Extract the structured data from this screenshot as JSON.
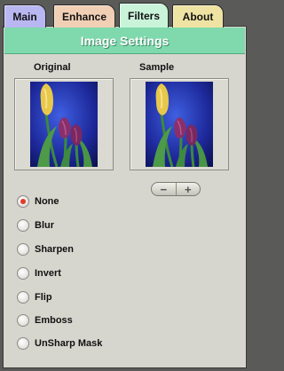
{
  "tabs": [
    {
      "label": "Main",
      "color": "#b9b6f2"
    },
    {
      "label": "Enhance",
      "color": "#f1cfb5"
    },
    {
      "label": "Filters",
      "color": "#c9f4d9",
      "active": true
    },
    {
      "label": "About",
      "color": "#efe3a3"
    }
  ],
  "header": {
    "title": "Image Settings",
    "color": "#7fd9ac"
  },
  "preview": {
    "original_label": "Original",
    "sample_label": "Sample"
  },
  "zoom": {
    "minus": "−",
    "plus": "+"
  },
  "filters": [
    {
      "label": "None",
      "selected": true
    },
    {
      "label": "Blur",
      "selected": false
    },
    {
      "label": "Sharpen",
      "selected": false
    },
    {
      "label": "Invert",
      "selected": false
    },
    {
      "label": "Flip",
      "selected": false
    },
    {
      "label": "Emboss",
      "selected": false
    },
    {
      "label": "UnSharp Mask",
      "selected": false
    }
  ]
}
